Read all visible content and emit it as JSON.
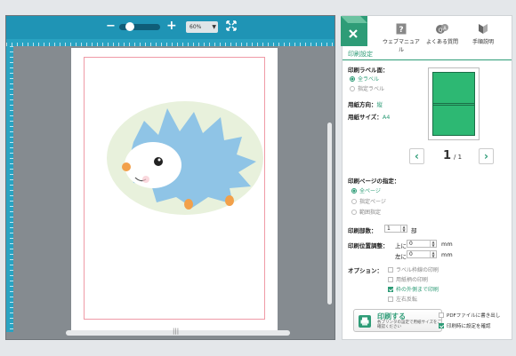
{
  "toolbar": {
    "zoom_minus": "−",
    "zoom_plus": "+",
    "zoom_value": "60%",
    "zoom_level": 0.2,
    "fit_icon": "expand-icon"
  },
  "tools": [
    {
      "label": "ウェブマニュアル",
      "icon": "help-icon"
    },
    {
      "label": "よくある質問",
      "icon": "faq-icon"
    },
    {
      "label": "手順説明",
      "icon": "beginner-mark-icon"
    }
  ],
  "panel": {
    "title": "印刷設定",
    "label_side_heading": "印刷ラベル面：",
    "label_side_options": [
      {
        "label": "全ラベル",
        "selected": true
      },
      {
        "label": "指定ラベル",
        "selected": false
      }
    ],
    "orientation_label": "用紙方向：",
    "orientation_value": "縦",
    "size_label": "用紙サイズ：",
    "size_value": "A4",
    "page_current": "1",
    "page_total": "/ 1",
    "page_range_heading": "印刷ページの指定：",
    "page_range_options": [
      {
        "label": "全ページ",
        "selected": true
      },
      {
        "label": "指定ページ",
        "selected": false
      },
      {
        "label": "範囲指定",
        "selected": false
      }
    ],
    "copies_label": "印刷部数：",
    "copies_value": "1",
    "copies_unit": "部",
    "offset_label": "印刷位置調整：",
    "offset_top_label": "上に",
    "offset_top_value": "0",
    "offset_left_label": "左に",
    "offset_left_value": "0",
    "offset_unit": "mm",
    "options_label": "オプション：",
    "options": [
      {
        "label": "ラベル枠線の印刷",
        "checked": false
      },
      {
        "label": "用紙柄の印刷",
        "checked": false
      },
      {
        "label": "枠の外側まで印刷",
        "checked": true
      },
      {
        "label": "左右反転",
        "checked": false
      }
    ],
    "print_button": "印刷する",
    "print_sub": "各プリンタの設定で用紙サイズをご確認ください",
    "pdf_option": "PDFファイルに書き出し",
    "confirm_option": "印刷時に設定を確認",
    "pdf_checked": false,
    "confirm_checked": true
  },
  "colors": {
    "accent": "#2e9c77",
    "toolbar": "#1f94b5",
    "label_fill": "#2db873"
  }
}
